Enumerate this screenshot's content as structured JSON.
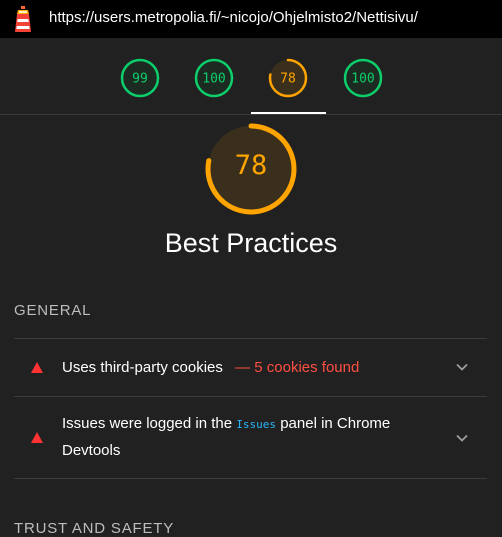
{
  "url_bar": {
    "url": "https://users.metropolia.fi/~nicojo/Ohjelmisto2/Nettisivu/"
  },
  "tabs": [
    {
      "score": "99",
      "color": "#0cce6b",
      "fill": 0.99
    },
    {
      "score": "100",
      "color": "#0cce6b",
      "fill": 1.0
    },
    {
      "score": "78",
      "color": "#ffa400",
      "fill": 0.78,
      "active": true
    },
    {
      "score": "100",
      "color": "#0cce6b",
      "fill": 1.0
    }
  ],
  "category": {
    "score": "78",
    "fill": 0.78,
    "color": "#ffa400",
    "title": "Best Practices"
  },
  "groups": [
    {
      "title": "GENERAL",
      "audits": [
        {
          "title": "Uses third-party cookies",
          "display": "— 5 cookies found"
        },
        {
          "title_before": "Issues were logged in the ",
          "code": "Issues",
          "title_after": " panel in Chrome Devtools"
        }
      ]
    },
    {
      "title": "TRUST AND SAFETY"
    }
  ],
  "colors": {
    "pass": "#0cce6b",
    "average": "#ffa400",
    "fail": "#ff4e42",
    "background": "#212121"
  }
}
